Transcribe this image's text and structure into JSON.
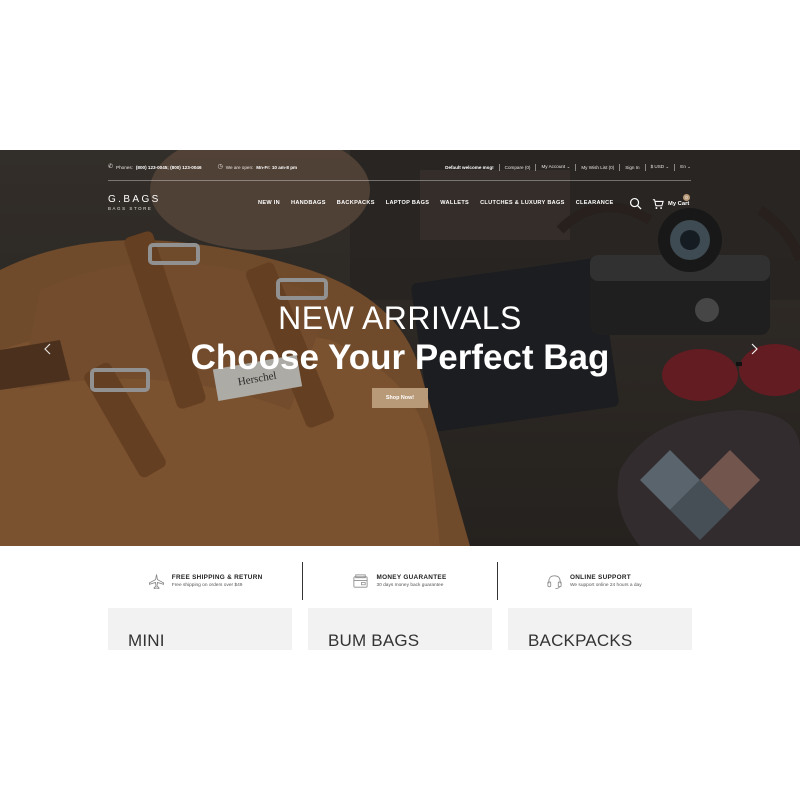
{
  "topbar": {
    "phones_label": "Phones:",
    "phones_value": "(800) 123-0045; (800) 123-0046",
    "hours_label": "We are open:",
    "hours_value": "Mn-Fr: 10 am-8 pm",
    "welcome": "Default welcome msg!",
    "links": [
      "Compare (0)",
      "My Account ⌄",
      "My Wish List (0)",
      "Sign In",
      "$ USD ⌄",
      "En ⌄"
    ]
  },
  "brand": {
    "logo": "G.BAGS",
    "tagline": "BAGS STORE"
  },
  "nav": {
    "items": [
      "NEW IN",
      "HANDBAGS",
      "BACKPACKS",
      "LAPTOP BAGS",
      "WALLETS",
      "CLUTCHES & LUXURY BAGS",
      "CLEARANCE"
    ],
    "cart_label": "My Cart",
    "cart_count": "0"
  },
  "hero": {
    "kicker": "NEW ARRIVALS",
    "title": "Choose Your Perfect Bag",
    "button": "Shop Now!",
    "label_patch": "Herschel"
  },
  "features": [
    {
      "title": "FREE SHIPPING & RETURN",
      "desc": "Free shipping on orders over $49",
      "icon": "airplane-icon"
    },
    {
      "title": "MONEY GUARANTEE",
      "desc": "30 days money back guarantee",
      "icon": "wallet-icon"
    },
    {
      "title": "ONLINE SUPPORT",
      "desc": "We support online 24 hours a day",
      "icon": "headset-icon"
    }
  ],
  "categories": [
    "MINI",
    "BUM BAGS",
    "BACKPACKS"
  ],
  "colors": {
    "accent": "#b89a78",
    "hero_dark": "#2b2622",
    "text_dark": "#222222",
    "card_bg": "#f2f2f2"
  }
}
